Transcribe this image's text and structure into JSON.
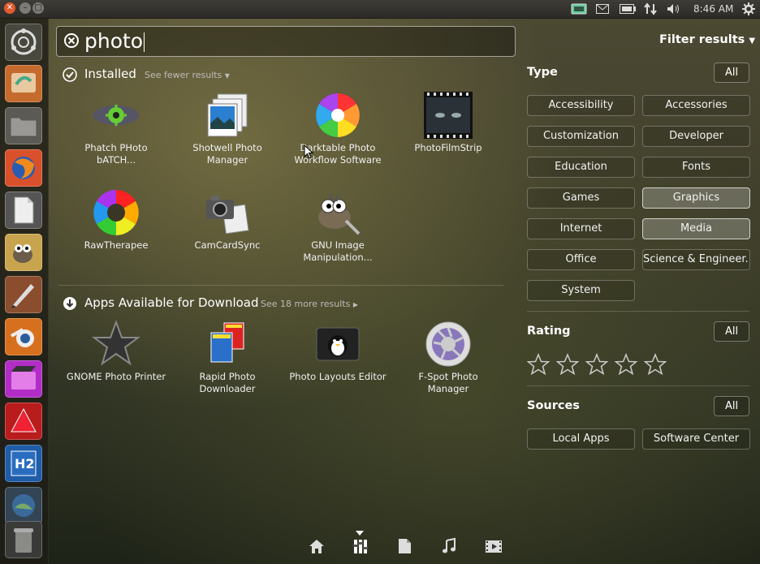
{
  "panel": {
    "clock": "8:46 AM"
  },
  "search": {
    "query": "photo"
  },
  "installed": {
    "title": "Installed",
    "toggle": "See fewer results",
    "apps": [
      {
        "label": "Phatch PHoto bATCH..."
      },
      {
        "label": "Shotwell Photo Manager"
      },
      {
        "label": "Darktable Photo Workflow Software"
      },
      {
        "label": "PhotoFilmStrip"
      },
      {
        "label": "RawTherapee"
      },
      {
        "label": "CamCardSync"
      },
      {
        "label": "GNU Image Manipulation..."
      }
    ]
  },
  "download": {
    "title": "Apps Available for Download",
    "toggle": "See 18 more results",
    "apps": [
      {
        "label": "GNOME Photo Printer"
      },
      {
        "label": "Rapid Photo Downloader"
      },
      {
        "label": "Photo Layouts Editor"
      },
      {
        "label": "F-Spot Photo Manager"
      }
    ]
  },
  "filters": {
    "title": "Filter results",
    "type": {
      "heading": "Type",
      "all": "All",
      "options": [
        {
          "label": "Accessibility",
          "active": false
        },
        {
          "label": "Accessories",
          "active": false
        },
        {
          "label": "Customization",
          "active": false
        },
        {
          "label": "Developer",
          "active": false
        },
        {
          "label": "Education",
          "active": false
        },
        {
          "label": "Fonts",
          "active": false
        },
        {
          "label": "Games",
          "active": false
        },
        {
          "label": "Graphics",
          "active": true
        },
        {
          "label": "Internet",
          "active": false
        },
        {
          "label": "Media",
          "active": true
        },
        {
          "label": "Office",
          "active": false
        },
        {
          "label": "Science & Engineer...",
          "active": false
        },
        {
          "label": "System",
          "active": false
        }
      ]
    },
    "rating": {
      "heading": "Rating",
      "all": "All",
      "stars": 5
    },
    "sources": {
      "heading": "Sources",
      "all": "All",
      "options": [
        {
          "label": "Local Apps"
        },
        {
          "label": "Software Center"
        }
      ]
    }
  },
  "lens_bar": [
    "home-icon",
    "applications-icon",
    "files-icon",
    "music-icon",
    "video-icon"
  ],
  "colors": {
    "accent": "#e2592d",
    "panel": "#2c2b27"
  }
}
